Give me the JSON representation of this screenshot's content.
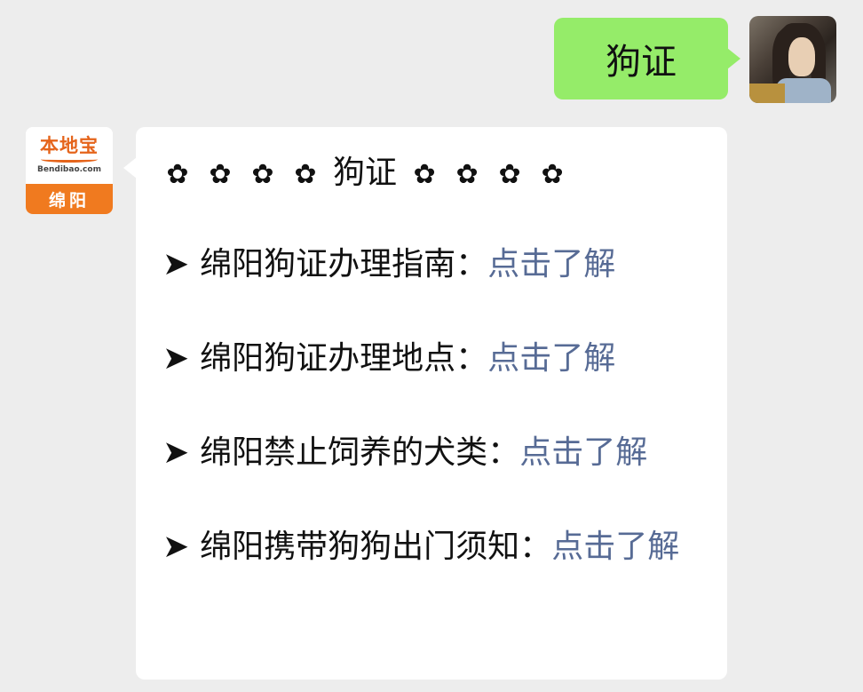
{
  "user_message": {
    "text": "狗证"
  },
  "bot": {
    "avatar": {
      "logo_text": "本地宝",
      "logo_subtext": "Bendibao.com",
      "city": "绵阳"
    },
    "title": {
      "flower": "✿",
      "text": "狗证"
    },
    "arrow": "➤",
    "items": [
      {
        "label": "绵阳狗证办理指南：",
        "link": "点击了解"
      },
      {
        "label": "绵阳狗证办理地点：",
        "link": "点击了解"
      },
      {
        "label": "绵阳禁止饲养的犬类：",
        "link": "点击了解"
      },
      {
        "label": "绵阳携带狗狗出门须知：",
        "link": "点击了解"
      }
    ]
  },
  "colors": {
    "background": "#ededed",
    "user_bubble": "#95ec69",
    "link": "#576b95",
    "brand_orange": "#f07a1f"
  }
}
